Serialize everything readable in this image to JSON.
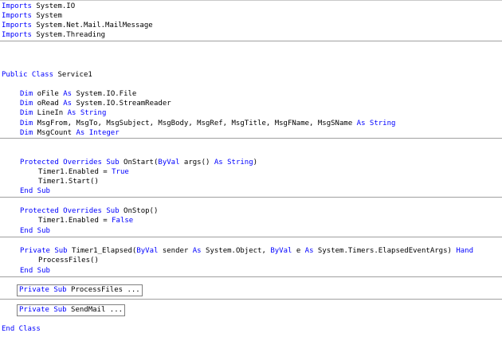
{
  "code": {
    "imports": [
      {
        "kw": "Imports",
        "rest": " System.IO"
      },
      {
        "kw": "Imports",
        "rest": " System"
      },
      {
        "kw": "Imports",
        "rest": " System.Net.Mail.MailMessage"
      },
      {
        "kw": "Imports",
        "rest": " System.Threading"
      }
    ],
    "class_decl": {
      "kw": "Public Class",
      "name": " Service1"
    },
    "dims": {
      "d1": {
        "kw1": "Dim",
        "mid": " oFile ",
        "kw2": "As",
        "type": " System.IO.File"
      },
      "d2": {
        "kw1": "Dim",
        "mid": " oRead ",
        "kw2": "As",
        "type": " System.IO.StreamReader"
      },
      "d3": {
        "kw1": "Dim",
        "mid": " LineIn ",
        "kw2": "As String"
      },
      "d4": {
        "kw1": "Dim",
        "mid": " MsgFrom, MsgTo, MsgSubject, MsgBody, MsgRef, MsgTitle, MsgFName, MsgSName ",
        "kw2": "As String"
      },
      "d5": {
        "kw1": "Dim",
        "mid": " MsgCount ",
        "kw2": "As Integer"
      }
    },
    "onstart": {
      "sig_kw": "Protected Overrides Sub",
      "sig_name": " OnStart(",
      "sig_kw2": "ByVal",
      "sig_mid": " args() ",
      "sig_kw3": "As String",
      "sig_end": ")",
      "l1_text": "Timer1.Enabled = ",
      "l1_kw": "True",
      "l2_text": "Timer1.Start()",
      "end": "End Sub"
    },
    "onstop": {
      "sig_kw": "Protected Overrides Sub",
      "sig_name": " OnStop()",
      "l1_text": "Timer1.Enabled = ",
      "l1_kw": "False",
      "end": "End Sub"
    },
    "elapsed": {
      "sig_kw": "Private Sub",
      "sig_name": " Timer1_Elapsed(",
      "kw_byval1": "ByVal",
      "sender": " sender ",
      "kw_as1": "As",
      "obj": " System.Object, ",
      "kw_byval2": "ByVal",
      "e": " e ",
      "kw_as2": "As",
      "args": " System.Timers.ElapsedEventArgs) ",
      "kw_handles": "Hand",
      "l1_text": "ProcessFiles()",
      "end": "End Sub"
    },
    "process_files": {
      "kw": "Private Sub",
      "rest": " ProcessFiles ..."
    },
    "send_mail": {
      "kw": "Private Sub",
      "rest": " SendMail ..."
    },
    "end_class": "End Class"
  }
}
